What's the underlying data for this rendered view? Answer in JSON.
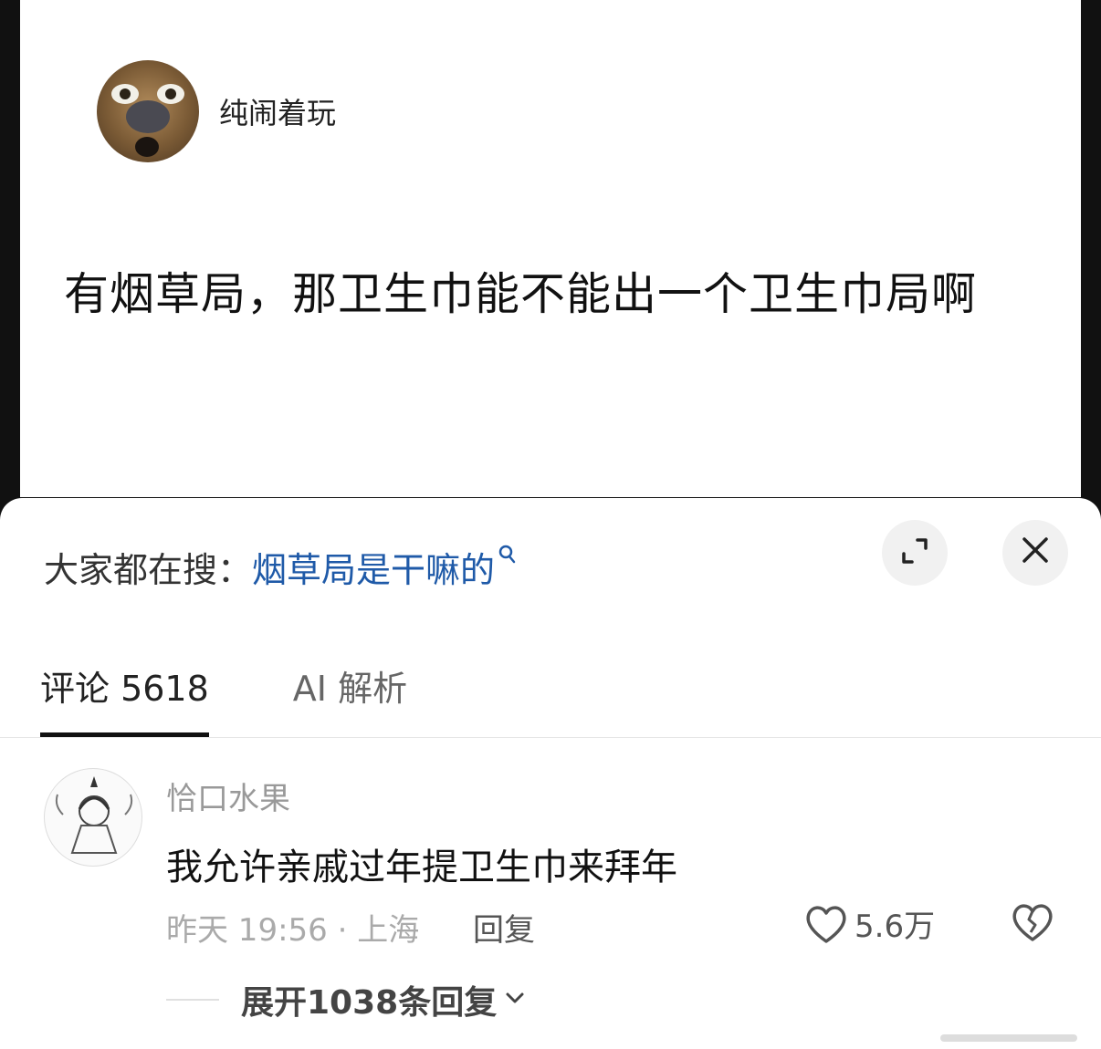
{
  "post": {
    "author": "纯闹着玩",
    "text": "有烟草局，那卫生巾能不能出一个卫生巾局啊"
  },
  "sheet": {
    "search_prefix": "大家都在搜：",
    "search_query": "烟草局是干嘛的",
    "tabs": [
      {
        "label": "评论 5618",
        "active": true
      },
      {
        "label": "AI 解析",
        "active": false
      }
    ]
  },
  "comment": {
    "username": "恰口水果",
    "text": "我允许亲戚过年提卫生巾来拜年",
    "meta": "昨天 19:56 · 上海",
    "reply_label": "回复",
    "likes": "5.6万"
  },
  "expand": {
    "label": "展开1038条回复"
  },
  "icons": {
    "search": "search-icon",
    "expand": "expand-icon",
    "close": "close-icon",
    "like": "heart-icon",
    "dislike": "broken-heart-icon",
    "chevron": "chevron-down-icon"
  },
  "colors": {
    "link": "#1f5aa8",
    "meta": "#aaaaaa"
  }
}
